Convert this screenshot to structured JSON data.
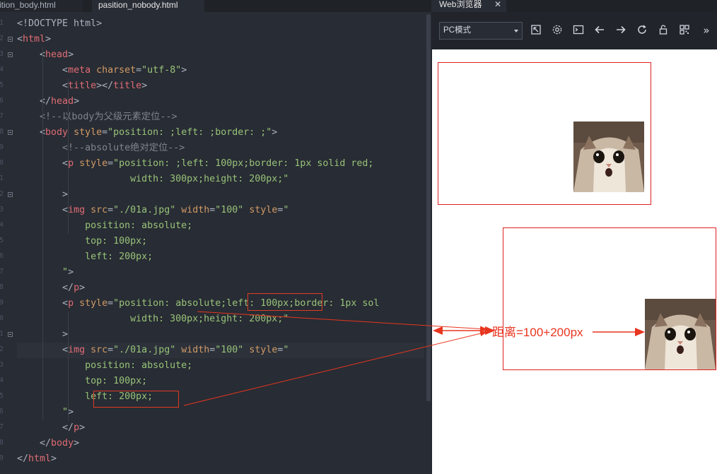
{
  "editor": {
    "tabs": [
      {
        "label": "sition_body.html"
      },
      {
        "label": "pasition_nobody.html"
      }
    ],
    "line_numbers": [
      "1",
      "2",
      "3",
      "4",
      "5",
      "6",
      "7",
      "8",
      "9",
      "0",
      "1",
      "2",
      "3",
      "4",
      "5",
      "6",
      "7",
      "8",
      "9",
      "0",
      "1",
      "2",
      "3",
      "4",
      "5",
      "6",
      "7",
      "8",
      "9"
    ],
    "lines": [
      [
        {
          "c": "pu",
          "t": "<!DOCTYPE html>"
        }
      ],
      [
        {
          "c": "pu",
          "t": "<"
        },
        {
          "c": "tg",
          "t": "html"
        },
        {
          "c": "pu",
          "t": ">"
        }
      ],
      [
        {
          "c": "pu",
          "t": "    <"
        },
        {
          "c": "tg",
          "t": "head"
        },
        {
          "c": "pu",
          "t": ">"
        }
      ],
      [
        {
          "c": "pu",
          "t": "        <"
        },
        {
          "c": "tg",
          "t": "meta"
        },
        {
          "c": "pu",
          "t": " "
        },
        {
          "c": "at",
          "t": "charset"
        },
        {
          "c": "pu",
          "t": "="
        },
        {
          "c": "st",
          "t": "\"utf-8\""
        },
        {
          "c": "pu",
          "t": ">"
        }
      ],
      [
        {
          "c": "pu",
          "t": "        <"
        },
        {
          "c": "tg",
          "t": "title"
        },
        {
          "c": "pu",
          "t": "></"
        },
        {
          "c": "tg",
          "t": "title"
        },
        {
          "c": "pu",
          "t": ">"
        }
      ],
      [
        {
          "c": "pu",
          "t": "    </"
        },
        {
          "c": "tg",
          "t": "head"
        },
        {
          "c": "pu",
          "t": ">"
        }
      ],
      [
        {
          "c": "cm",
          "t": "    <!--以body为父级元素定位-->"
        }
      ],
      [
        {
          "c": "pu",
          "t": "    <"
        },
        {
          "c": "tg",
          "t": "body"
        },
        {
          "c": "pu",
          "t": " "
        },
        {
          "c": "at",
          "t": "style"
        },
        {
          "c": "pu",
          "t": "="
        },
        {
          "c": "st",
          "t": "\"position: ;left: ;border: ;\""
        },
        {
          "c": "pu",
          "t": ">"
        }
      ],
      [
        {
          "c": "cm",
          "t": "        <!--absolute绝对定位-->"
        }
      ],
      [
        {
          "c": "pu",
          "t": "        <"
        },
        {
          "c": "tg",
          "t": "p"
        },
        {
          "c": "pu",
          "t": " "
        },
        {
          "c": "at",
          "t": "style"
        },
        {
          "c": "pu",
          "t": "="
        },
        {
          "c": "st",
          "t": "\"position: ;left: 100px;border: 1px solid red;"
        }
      ],
      [
        {
          "c": "st",
          "t": "                    width: 300px;height: 200px;\""
        }
      ],
      [
        {
          "c": "pu",
          "t": "        >"
        }
      ],
      [
        {
          "c": "pu",
          "t": "        <"
        },
        {
          "c": "tg",
          "t": "img"
        },
        {
          "c": "pu",
          "t": " "
        },
        {
          "c": "at",
          "t": "src"
        },
        {
          "c": "pu",
          "t": "="
        },
        {
          "c": "st",
          "t": "\"./01a.jpg\""
        },
        {
          "c": "pu",
          "t": " "
        },
        {
          "c": "at",
          "t": "width"
        },
        {
          "c": "pu",
          "t": "="
        },
        {
          "c": "st",
          "t": "\"100\""
        },
        {
          "c": "pu",
          "t": " "
        },
        {
          "c": "at",
          "t": "style"
        },
        {
          "c": "pu",
          "t": "="
        },
        {
          "c": "st",
          "t": "\""
        }
      ],
      [
        {
          "c": "st",
          "t": "            position: absolute;"
        }
      ],
      [
        {
          "c": "st",
          "t": "            top: 100px;"
        }
      ],
      [
        {
          "c": "st",
          "t": "            left: 200px;"
        }
      ],
      [
        {
          "c": "st",
          "t": "        \""
        },
        {
          "c": "pu",
          "t": ">"
        }
      ],
      [
        {
          "c": "pu",
          "t": "        </"
        },
        {
          "c": "tg",
          "t": "p"
        },
        {
          "c": "pu",
          "t": ">"
        }
      ],
      [
        {
          "c": "pu",
          "t": "        <"
        },
        {
          "c": "tg",
          "t": "p"
        },
        {
          "c": "pu",
          "t": " "
        },
        {
          "c": "at",
          "t": "style"
        },
        {
          "c": "pu",
          "t": "="
        },
        {
          "c": "st",
          "t": "\"position: absolute;left: 100px;border: 1px sol"
        }
      ],
      [
        {
          "c": "st",
          "t": "                    width: 300px;height: 200px;\""
        }
      ],
      [
        {
          "c": "pu",
          "t": "        >"
        }
      ],
      [
        {
          "c": "pu",
          "t": "        <"
        },
        {
          "c": "tg",
          "t": "img"
        },
        {
          "c": "pu",
          "t": " "
        },
        {
          "c": "at",
          "t": "src"
        },
        {
          "c": "pu",
          "t": "="
        },
        {
          "c": "st",
          "t": "\"./01a.jpg\""
        },
        {
          "c": "pu",
          "t": " "
        },
        {
          "c": "at",
          "t": "width"
        },
        {
          "c": "pu",
          "t": "="
        },
        {
          "c": "st",
          "t": "\"100\""
        },
        {
          "c": "pu",
          "t": " "
        },
        {
          "c": "at",
          "t": "style"
        },
        {
          "c": "pu",
          "t": "="
        },
        {
          "c": "st",
          "t": "\""
        }
      ],
      [
        {
          "c": "st",
          "t": "            position: absolute;"
        }
      ],
      [
        {
          "c": "st",
          "t": "            top: 100px;"
        }
      ],
      [
        {
          "c": "st",
          "t": "            left: 200px;"
        }
      ],
      [
        {
          "c": "st",
          "t": "        \""
        },
        {
          "c": "pu",
          "t": ">"
        }
      ],
      [
        {
          "c": "pu",
          "t": "        </"
        },
        {
          "c": "tg",
          "t": "p"
        },
        {
          "c": "pu",
          "t": ">"
        }
      ],
      [
        {
          "c": "pu",
          "t": "    </"
        },
        {
          "c": "tg",
          "t": "body"
        },
        {
          "c": "pu",
          "t": ">"
        }
      ],
      [
        {
          "c": "pu",
          "t": "</"
        },
        {
          "c": "tg",
          "t": "html"
        },
        {
          "c": "pu",
          "t": ">"
        }
      ]
    ]
  },
  "browser": {
    "tab_label": "Web浏览器",
    "tab_close": "✕",
    "mode_value": "PC模式",
    "more_label": "»"
  },
  "annotation": {
    "label": "距离=100+200px",
    "color": "#e8351f"
  }
}
